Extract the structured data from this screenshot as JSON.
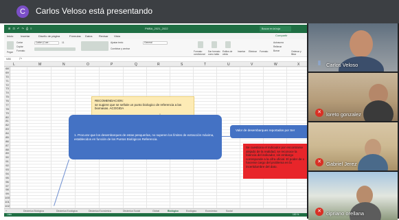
{
  "meeting": {
    "presenter_initial": "C",
    "presenting_title": "Carlos Veloso está presentando"
  },
  "excel": {
    "file_title": "PMBA_2021_2022",
    "quick_access": "⊞ ⊡ ↶ ↷ ⎙ ≡",
    "search_placeholder": "Buscar en la hoja",
    "share_label": "Compartir",
    "menu": [
      "Inicio",
      "Insertar",
      "Diseño de página",
      "Fórmulas",
      "Datos",
      "Revisar",
      "Vista"
    ],
    "ribbon": {
      "paste": "Pegar",
      "cut": "Cortar",
      "copy": "Copiar",
      "format": "Formato",
      "font": "Calibri (Cuer...",
      "font_size": "11",
      "wrap": "Ajustar texto",
      "merge": "Combinar y centrar",
      "number_format": "General",
      "cond_format": "Formato condicional",
      "table_format": "Dar formato como tabla",
      "cell_styles": "Estilos de celda",
      "insert": "Insertar",
      "delete": "Eliminar",
      "format_cells": "Formato",
      "autosum": "Autosuma",
      "fill": "Rellenar",
      "clear": "Borrar",
      "sort": "Ordenar y filtrar"
    },
    "name_box": "M86",
    "columns": [
      "L",
      "M",
      "N",
      "O",
      "P",
      "Q",
      "R",
      "S",
      "T",
      "U",
      "V",
      "W",
      "X"
    ],
    "rows": [
      "68",
      "69",
      "70",
      "71",
      "72",
      "73",
      "74",
      "75",
      "76",
      "77",
      "78",
      "79",
      "80",
      "81",
      "82",
      "83",
      "84",
      "85",
      "86",
      "87",
      "88",
      "89",
      "90",
      "91",
      "92",
      "93",
      "94",
      "95",
      "96",
      "97",
      "98",
      "99",
      "100",
      "101",
      "102"
    ],
    "yellow_note": "RECOMENDACION:\nse sugiere que se señale un punto biologico de referencia a las biomasas. ACOGIDA",
    "blue_box_1": "1. Procurar que los desembarques de estas pesquerías, no superen los límites de extracción máxima, establecidos en función de los Puntos Biológicos Referencia.",
    "blue_box_2": "Valor de desembarques reportados por Ser",
    "red_box": "Se cuestiona el indicador por encontrarse alejado de la realidad, se reconoce la falencia del indicador, sin embargo corresponde a la cifra oficial. El poder de x hacerse cargo del problema en la incertidumbre del dato.",
    "sheet_tabs": [
      "Dinámica Biológica",
      "Dinámica Ecológica",
      "Dinámica Económica",
      "Dinámica Social",
      "Global",
      "Biológico",
      "Ecológico",
      "Económico",
      "Social"
    ],
    "active_tab": "Biológico",
    "status_ready": "Listo",
    "zoom": "100 %"
  },
  "participants": [
    {
      "name": "Carlos Veloso",
      "muted": false
    },
    {
      "name": "loreto gonzalez",
      "muted": true
    },
    {
      "name": "Gabriel Jerez",
      "muted": true
    },
    {
      "name": "cipriano orellana",
      "muted": true
    }
  ],
  "colors": {
    "excel_green": "#1f6e43",
    "shape_blue": "#4472c4",
    "note_yellow": "#fdebb5",
    "alert_red": "#e8252a",
    "mic_muted": "#d93025"
  }
}
